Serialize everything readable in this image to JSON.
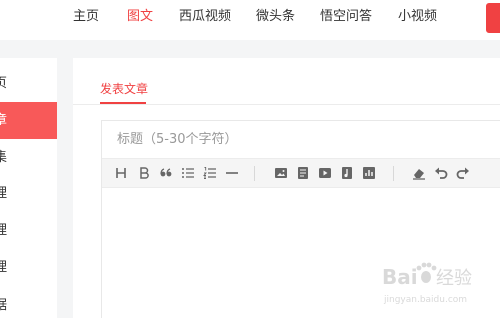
{
  "topnav": {
    "items": [
      "主页",
      "图文",
      "西瓜视频",
      "微头条",
      "悟空问答",
      "小视频"
    ],
    "active": "图文",
    "accent": "#f04142"
  },
  "sidebar": {
    "items": [
      "页",
      "章",
      "集",
      "理",
      "理",
      "理",
      "据"
    ],
    "active_index": 1,
    "active_color": "#f85959"
  },
  "tabs": {
    "publish_label": "发表文章"
  },
  "editor": {
    "title_placeholder": "标题（5-30个字符）",
    "toolbar_icons": [
      "heading-icon",
      "bold-icon",
      "quote-icon",
      "bullet-list-icon",
      "numbered-list-icon",
      "divider-icon",
      "image-icon",
      "document-icon",
      "video-icon",
      "audio-icon",
      "chart-icon",
      "eraser-icon",
      "undo-icon",
      "redo-icon"
    ]
  },
  "watermark": {
    "brand": "Baidu 经验",
    "url": "jingyan.baidu.com"
  }
}
